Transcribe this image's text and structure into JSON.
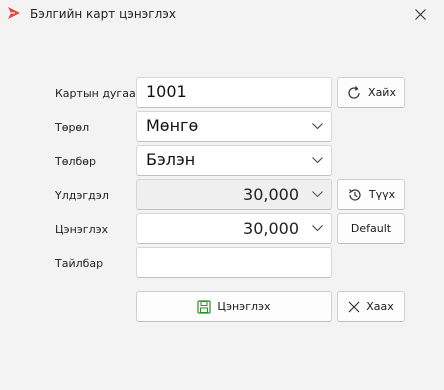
{
  "window": {
    "title": "Бэлгийн карт цэнэглэх"
  },
  "form": {
    "card_number": {
      "label": "Картын дугаар",
      "value": "1001"
    },
    "type": {
      "label": "Төрөл",
      "value": "Мөнгө"
    },
    "payment": {
      "label": "Төлбөр",
      "value": "Бэлэн"
    },
    "balance": {
      "label": "Үлдэгдэл",
      "value": "30,000"
    },
    "recharge": {
      "label": "Цэнэглэх",
      "value": "30,000"
    },
    "note": {
      "label": "Тайлбар",
      "value": ""
    }
  },
  "buttons": {
    "search": "Хайх",
    "history": "Түүх",
    "default": "Default",
    "save": "Цэнэглэх",
    "close": "Хаах"
  },
  "colors": {
    "accent": "#e2473b",
    "save_icon": "#2e8b2e"
  }
}
